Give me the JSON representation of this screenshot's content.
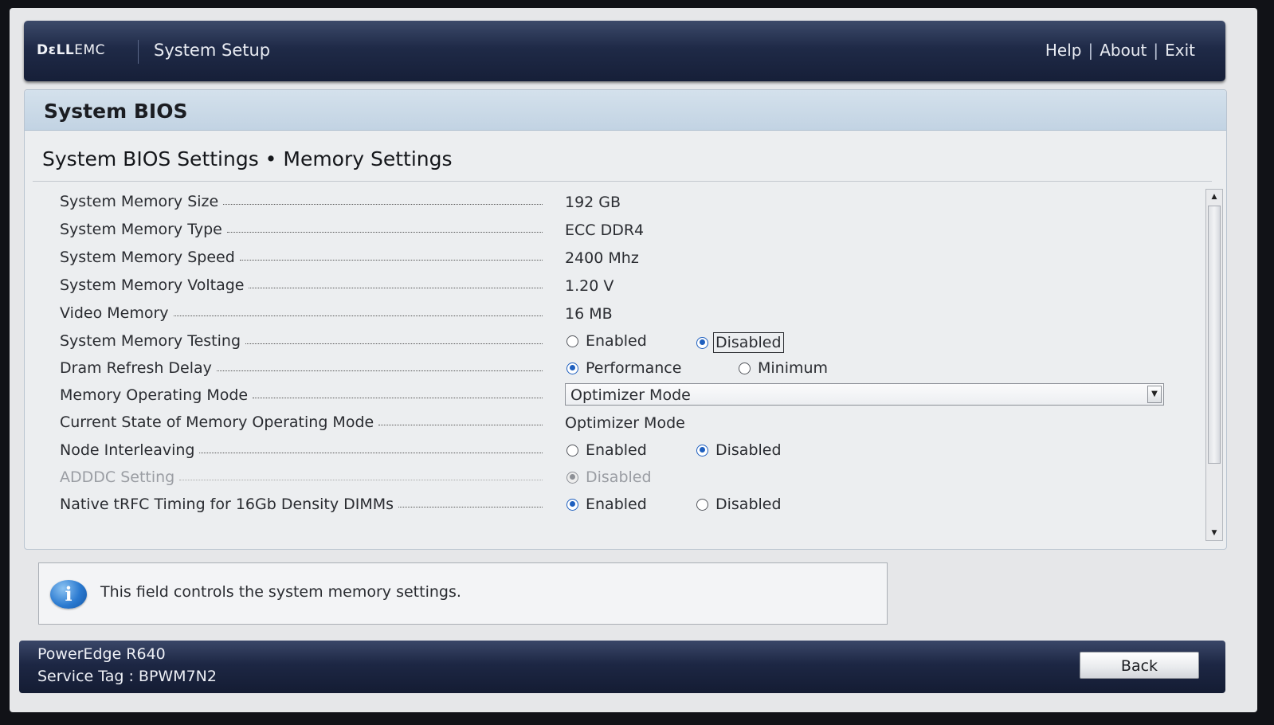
{
  "header": {
    "brand_bold": "DɛLL",
    "brand_rest": "EMC",
    "app_title": "System Setup",
    "links": {
      "help": "Help",
      "about": "About",
      "exit": "Exit",
      "separator": "|"
    }
  },
  "panel": {
    "title": "System BIOS",
    "breadcrumb": "System BIOS Settings • Memory Settings"
  },
  "settings": {
    "memory_size": {
      "label": "System Memory Size",
      "value": "192 GB"
    },
    "memory_type": {
      "label": "System Memory Type",
      "value": "ECC DDR4"
    },
    "memory_speed": {
      "label": "System Memory Speed",
      "value": "2400 Mhz"
    },
    "memory_voltage": {
      "label": "System Memory Voltage",
      "value": "1.20 V"
    },
    "video_memory": {
      "label": "Video Memory",
      "value": "16 MB"
    },
    "memory_testing": {
      "label": "System Memory Testing",
      "options": [
        "Enabled",
        "Disabled"
      ],
      "selected": "Disabled"
    },
    "dram_refresh": {
      "label": "Dram Refresh Delay",
      "options": [
        "Performance",
        "Minimum"
      ],
      "selected": "Performance"
    },
    "operating_mode": {
      "label": "Memory Operating Mode",
      "value": "Optimizer Mode"
    },
    "current_mode": {
      "label": "Current State of Memory Operating Mode",
      "value": "Optimizer Mode"
    },
    "node_interleaving": {
      "label": "Node Interleaving",
      "options": [
        "Enabled",
        "Disabled"
      ],
      "selected": "Disabled"
    },
    "adddc": {
      "label": "ADDDC Setting",
      "options": [
        "Disabled"
      ],
      "selected": "Disabled"
    },
    "native_trfc": {
      "label": "Native tRFC Timing for 16Gb Density DIMMs",
      "options": [
        "Enabled",
        "Disabled"
      ],
      "selected": "Enabled"
    }
  },
  "help": {
    "icon": "info-icon",
    "icon_glyph": "i",
    "text": "This field controls the system memory settings."
  },
  "footer": {
    "model": "PowerEdge R640",
    "service_tag": "Service Tag : BPWM7N2",
    "back_label": "Back"
  },
  "colors": {
    "header_bar": "#1f2a47",
    "panel_head": "#c8d8e6",
    "radio_selected": "#1e5fbf"
  }
}
